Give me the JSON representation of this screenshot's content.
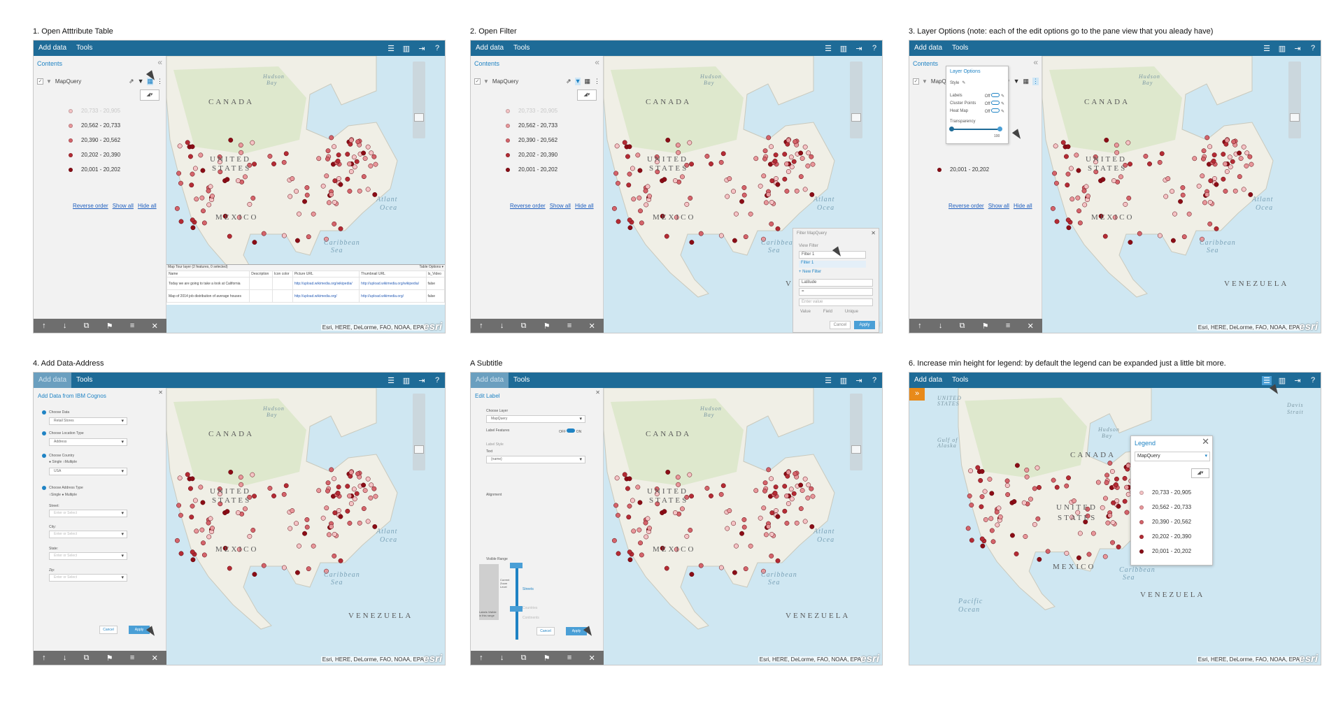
{
  "panels": [
    {
      "caption": "1. Open Atttribute Table"
    },
    {
      "caption": "2. Open Filter"
    },
    {
      "caption": "3. Layer Options (note: each of the edit options go to the pane view that you aleady have)"
    },
    {
      "caption": "4. Add Data-Address"
    },
    {
      "caption": "A Subtitle"
    },
    {
      "caption": "6. Increase min height for legend: by default the legend can be expanded just a little bit more."
    }
  ],
  "toolbar": {
    "add_data": "Add data",
    "tools": "Tools"
  },
  "contents": {
    "title": "Contents",
    "layer_name": "MapQuery",
    "legend": [
      {
        "label": "20,733 - 20,905",
        "color": "#f4c3c5"
      },
      {
        "label": "20,562 - 20,733",
        "color": "#e8979b"
      },
      {
        "label": "20,390 - 20,562",
        "color": "#d4646b"
      },
      {
        "label": "20,202 - 20,390",
        "color": "#b42c35"
      },
      {
        "label": "20,001 - 20,202",
        "color": "#8b0d16"
      }
    ],
    "links": {
      "reverse": "Reverse order",
      "show_all": "Show all",
      "hide_all": "Hide all"
    }
  },
  "map": {
    "canada": "CANADA",
    "united": "UNITED",
    "states": "STATES",
    "mexico": "MEXICO",
    "venezuela": "VENEZUELA",
    "hudson": "Hudson",
    "bay": "Bay",
    "atlantic": "Atlant",
    "ocean": "Ocea",
    "caribbean": "Caribbean",
    "sea": "Sea",
    "pacific": "Pacific",
    "pacific_ocean": "Ocean",
    "united_small": "UNITED",
    "states_small": "STATES",
    "gulf": "Gulf of",
    "alaska": "Alaska",
    "davis": "Davis",
    "strait": "Strait",
    "attribution": "Esri, HERE, DeLorme, FAO, NOAA, EPA",
    "attribution_short": "Esri, HERE,",
    "logo": "esri"
  },
  "attr_table": {
    "header_left": "Map Tour layer (2 features, 0 selected)",
    "header_right": "Table Options ▾",
    "columns": [
      "Name",
      "Description",
      "Icon color",
      "Picture URL",
      "Thumbnail URL",
      "Is_Video"
    ],
    "rows": [
      [
        "Today we are going to take a look at California",
        "",
        "",
        "http://upload.wikimedia.org/wikipedia/",
        "http://upload.wikimedia.org/wikipedia/",
        "false"
      ],
      [
        "Map of 2014 job distribution of average houses",
        "",
        "",
        "http://upload.wikimedia.org/",
        "http://upload.wikimedia.org/",
        "false"
      ]
    ]
  },
  "filter": {
    "title": "Filter MapQuery",
    "view_filter": "View Filter",
    "filter1": "Filter 1",
    "filter1_item": "Filter 1",
    "new_filter": "+ New Filter",
    "field": "Latitude",
    "operator": "=",
    "enter_value": "Enter value",
    "opt_value": "Value",
    "opt_field": "Field",
    "opt_unique": "Unique",
    "cancel": "Cancel",
    "apply": "Apply"
  },
  "layer_options": {
    "title": "Layer Options",
    "style": "Style",
    "labels": "Labels",
    "cluster": "Cluster Points",
    "heatmap": "Heat Map",
    "off": "Off",
    "transparency": "Transparency",
    "value": "100",
    "legend_last": "20,001 - 20,202"
  },
  "add_data": {
    "title": "Add Data from IBM Cognos",
    "choose_data": "Choose Data",
    "data_value": "Retail Stores",
    "loc_type": "Choose Location Type",
    "loc_value": "Address",
    "country": "Choose Country",
    "single": "Single",
    "multiple": "Multiple",
    "country_value": "USA",
    "addr_type": "Choose Address Type",
    "street": "Street:",
    "city": "City:",
    "state": "State:",
    "zip": "Zip:",
    "placeholder": "Enter or Select",
    "cancel": "Cancel",
    "apply": "Apply"
  },
  "edit_label": {
    "title": "Edit Label",
    "choose_layer": "Choose Layer",
    "layer_value": "MapQuery",
    "label_features": "Label Features",
    "off": "OFF",
    "on": "ON",
    "label_style": "Label Style",
    "text": "Text",
    "text_value": "{name}",
    "alignment": "Alignment",
    "visible_range": "Visible Range",
    "current_zoom": "Current Zoom Level",
    "labels_visible": "Labels Visible in this range",
    "streets": "Streets",
    "countries": "Countries",
    "continents": "Continents",
    "cancel": "Cancel",
    "apply": "Apply"
  },
  "legend_popup": {
    "title": "Legend",
    "layer": "MapQuery",
    "close": "✕"
  }
}
